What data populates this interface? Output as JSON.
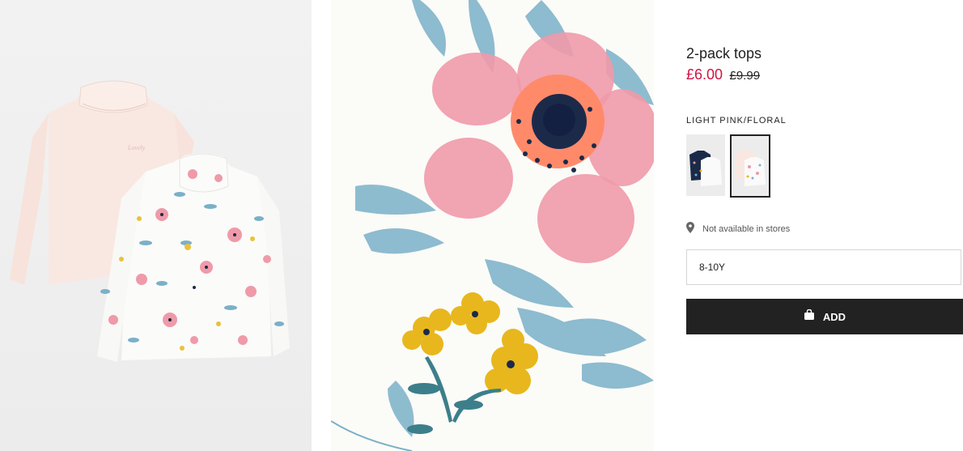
{
  "product": {
    "title": "2-pack tops",
    "price_sale": "£6.00",
    "price_original": "£9.99",
    "color_name": "LIGHT PINK/FLORAL",
    "swatches": [
      {
        "icon": "navy-floral-pack-thumbnail",
        "selected": false
      },
      {
        "icon": "pink-floral-pack-thumbnail",
        "selected": true
      }
    ],
    "store_availability": "Not available in stores",
    "size_selected": "8-10Y",
    "add_label": "ADD"
  },
  "colors": {
    "sale_red": "#d01345",
    "button_bg": "#222222",
    "button_text": "#ffffff",
    "light_pink": "#f9e8e2",
    "floral_pink": "#ef9aa8",
    "floral_blue": "#7ab0c8",
    "floral_yellow": "#e8b71d",
    "navy": "#1c2a4a"
  },
  "icons": {
    "location": "location-pin-icon",
    "bag": "shopping-bag-icon"
  }
}
